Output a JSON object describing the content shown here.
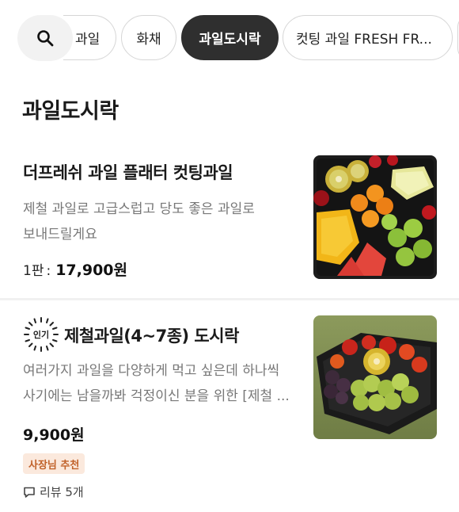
{
  "chips": {
    "items": [
      {
        "label": "과일"
      },
      {
        "label": "화채"
      },
      {
        "label": "과일도시락",
        "active": true
      },
      {
        "label": "컷팅 과일 FRESH FR..."
      },
      {
        "label": ""
      }
    ]
  },
  "section": {
    "title": "과일도시락"
  },
  "products": [
    {
      "name": "더프레쉬 과일 플래터 컷팅과일",
      "description_lines": [
        "제철 과일로 고급스럽고 당도 좋은 과일로",
        "보내드릴게요"
      ],
      "price_prefix": "1판",
      "price_separator": ":",
      "price": "17,900원"
    },
    {
      "badge": "인기",
      "name": "제철과일(4~7종) 도시락",
      "description_lines": [
        "여러가지 과일을 다양하게 먹고 싶은데 하나씩",
        "사기에는 남을까봐 걱정이신 분을 위한 [제철 ..."
      ],
      "price": "9,900원",
      "tag": "사장님 추천",
      "review": "리뷰 5개"
    }
  ],
  "colors": {
    "active_chip": "#2f2f2f",
    "owner_tag_bg": "#fbe9dd",
    "owner_tag_text": "#c1622a"
  },
  "icons": {
    "search": "search-icon",
    "review": "speech-bubble-icon",
    "popular": "sunburst-badge-icon"
  }
}
